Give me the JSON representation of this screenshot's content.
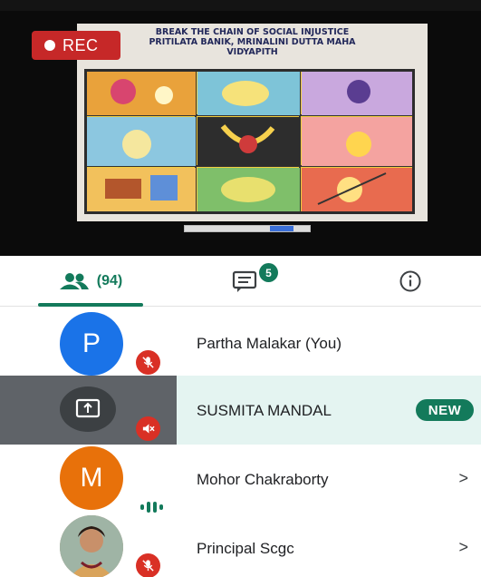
{
  "video": {
    "rec_label": "REC",
    "slide_title_line1": "BREAK THE CHAIN OF SOCIAL INJUSTICE",
    "slide_title_line2": "PRITILATA BANIK, MRINALINI DUTTA MAHA",
    "slide_title_line3": "VIDYAPITH"
  },
  "tabs": {
    "people_count": "(94)",
    "chat_unread": "5"
  },
  "participants": [
    {
      "name": "Partha Malakar (You)",
      "avatar_letter": "P",
      "avatar_color": "#1a73e8",
      "muted": true
    },
    {
      "name": "SUSMITA MANDAL",
      "badge": "NEW",
      "presenting": true,
      "muted": true
    },
    {
      "name": "Mohor Chakraborty",
      "avatar_letter": "M",
      "avatar_color": "#e8710a",
      "speaking": true
    },
    {
      "name": "Principal Scgc",
      "muted": true
    }
  ],
  "colors": {
    "accent": "#137a5b",
    "rec": "#c62828",
    "mute": "#d93025"
  }
}
